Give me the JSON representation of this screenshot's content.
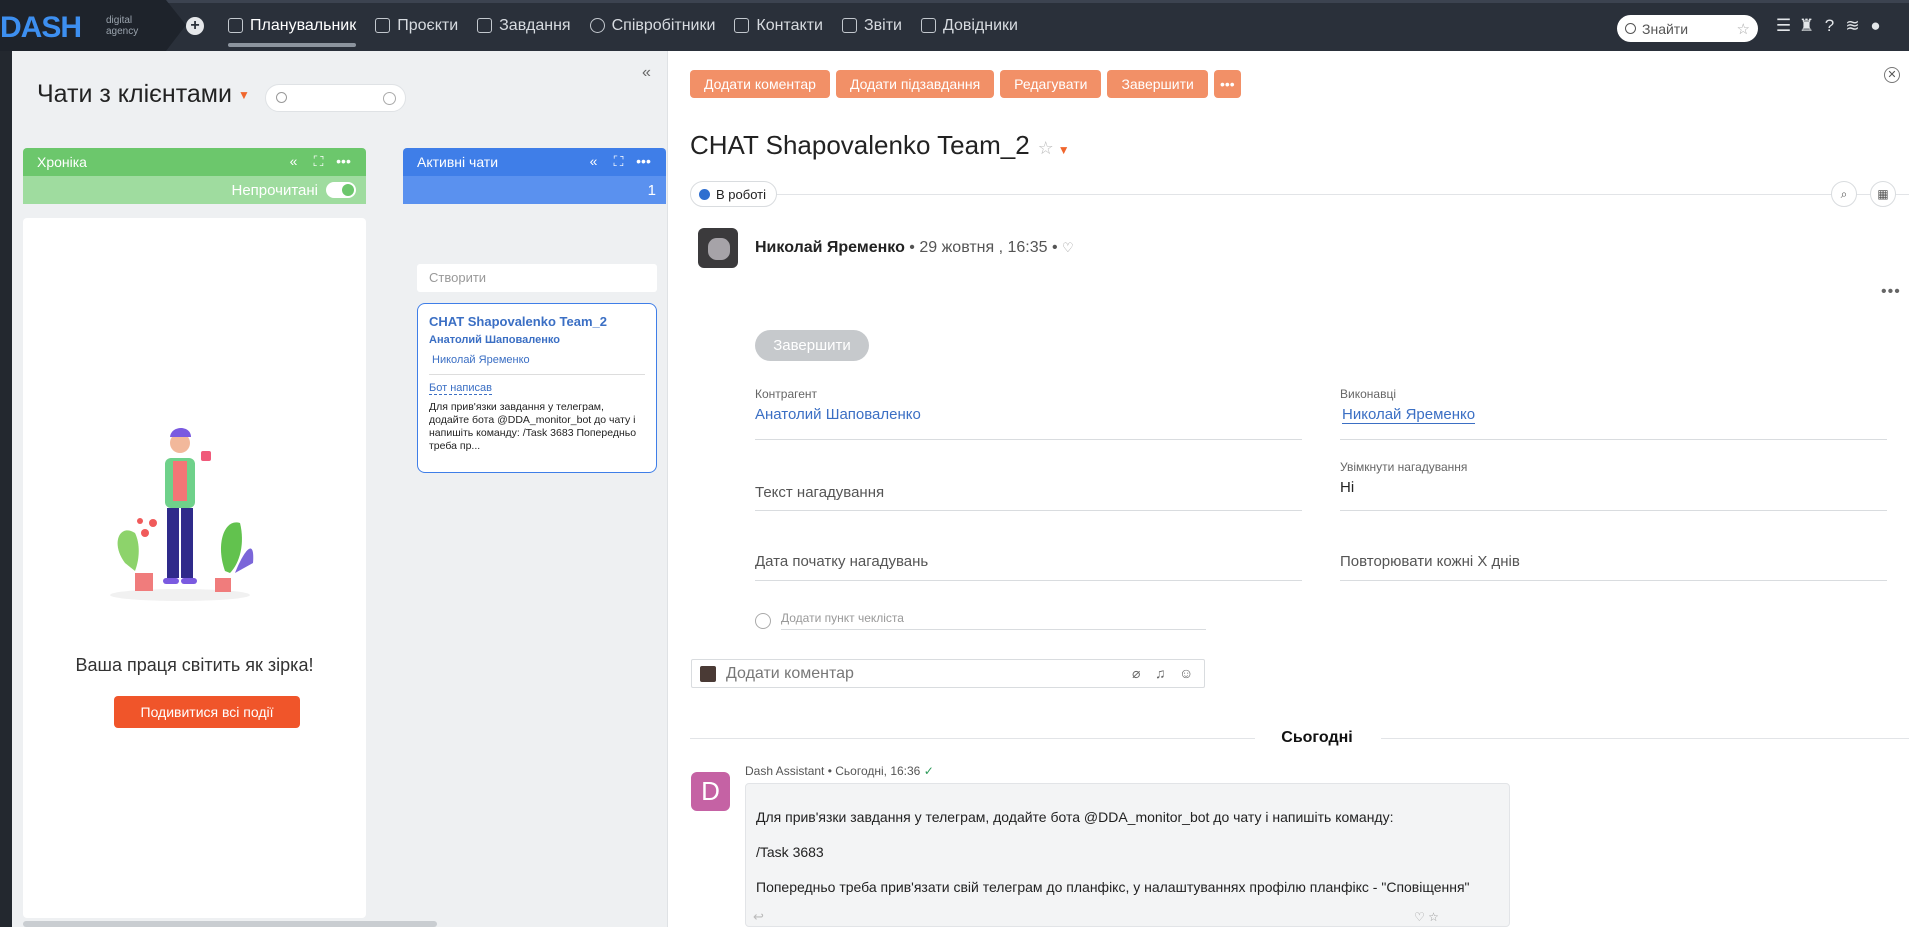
{
  "brand": {
    "name": "DASH",
    "sub1": "digital",
    "sub2": "agency"
  },
  "nav": {
    "items": [
      {
        "label": "Планувальник",
        "icon": "planner-icon",
        "active": true
      },
      {
        "label": "Проєкти",
        "icon": "projects-icon"
      },
      {
        "label": "Завдання",
        "icon": "tasks-icon"
      },
      {
        "label": "Співробітники",
        "icon": "employees-icon"
      },
      {
        "label": "Контакти",
        "icon": "contacts-icon"
      },
      {
        "label": "Звіти",
        "icon": "reports-icon"
      },
      {
        "label": "Довідники",
        "icon": "directories-icon"
      }
    ],
    "search_placeholder": "Знайти"
  },
  "left_panel": {
    "title": "Чати з клієнтами",
    "columns": {
      "chronicle": {
        "title": "Хроніка",
        "toggle_label": "Непрочитані",
        "color": "#6cc76c"
      },
      "active": {
        "title": "Активні чати",
        "count": "1",
        "color": "#3f7ee8"
      }
    },
    "create_placeholder": "Створити",
    "empty": {
      "text": "Ваша праця світить як зірка!",
      "button": "Подивитися всі події"
    },
    "card": {
      "title": "CHAT Shapovalenko Team_2",
      "author": "Анатолий Шаповаленко",
      "assignee": "Николай Яременко",
      "bot_label": "Бот написав",
      "text": "Для прив'язки завдання у телеграм, додайте бота @DDA_monitor_bot до чату і напишіть команду:     /Task 3683    Попередньо треба пр..."
    }
  },
  "task": {
    "actions": [
      "Додати коментар",
      "Додати підзавдання",
      "Редагувати",
      "Завершити"
    ],
    "title": "CHAT Shapovalenko Team_2",
    "status": "В роботі",
    "status_color": "#2f6fd0",
    "author": "Николай Яременко",
    "date": "29 жовтня , 16:35",
    "complete_button": "Завершити",
    "fields": {
      "contractor_label": "Контрагент",
      "contractor": "Анатолий Шаповаленко",
      "executors_label": "Виконавці",
      "executor": "Николай Яременко",
      "reminder_text_placeholder": "Текст нагадування",
      "reminders_enabled_label": "Увімкнути нагадування",
      "reminders_enabled": "Ні",
      "reminder_start_placeholder": "Дата початку нагадувань",
      "repeat_placeholder": "Повторювати кожні Х днів"
    },
    "checklist_placeholder": "Додати пункт чекліста",
    "comment_placeholder": "Додати коментар"
  },
  "feed": {
    "day_label": "Сьогодні",
    "message": {
      "avatar_letter": "D",
      "author": "Dash Assistant",
      "time": "Сьогодні, 16:36",
      "line1": "Для прив'язки завдання у телеграм, додайте бота @DDA_monitor_bot до чату і напишіть команду:",
      "line2": "/Task 3683",
      "line3": "Попередньо треба прив'язати свій телеграм до планфікс, у налаштуваннях профілю планфікс - \"Сповіщення\""
    }
  }
}
